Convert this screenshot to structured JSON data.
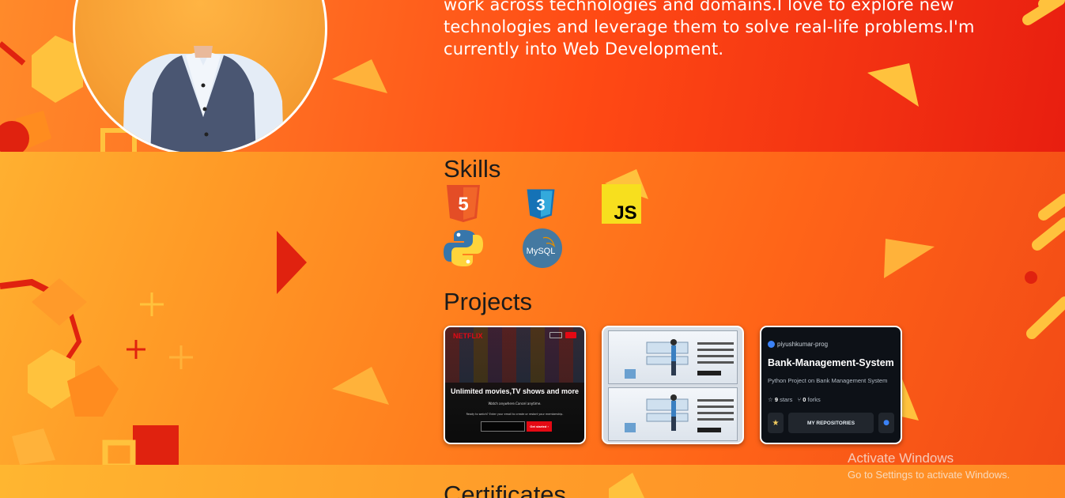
{
  "about": {
    "text": "work across technologies and domains.I love to explore new technologies and leverage them to solve real-life problems.I'm currently into Web Development."
  },
  "skills": {
    "title": "Skills",
    "items": [
      {
        "name": "HTML5",
        "icon": "html5-icon",
        "glyph": "5",
        "color": "#e44d26"
      },
      {
        "name": "CSS3",
        "icon": "css3-icon",
        "glyph": "3",
        "color": "#1572b6"
      },
      {
        "name": "JavaScript",
        "icon": "javascript-icon",
        "glyph": "JS",
        "color": "#f7df1e"
      },
      {
        "name": "Python",
        "icon": "python-icon",
        "color": "#3776ab"
      },
      {
        "name": "MySQL",
        "icon": "mysql-icon",
        "glyph": "MySQL",
        "color": "#4479a1"
      }
    ]
  },
  "projects": {
    "title": "Projects",
    "netflix": {
      "logo": "NETFLIX",
      "headline": "Unlimited movies,TV shows and more",
      "sub": "Watch anywhere.Cancel anytime.",
      "ready": "Ready to watch? Enter your email to create or restart your membership.",
      "cta": "Get started ›"
    },
    "repo": {
      "owner": "piyushkumar-prog",
      "name": "Bank-Management-System",
      "description": "Python Project on Bank Management System",
      "stars_count": "9",
      "stars_label": "stars",
      "forks_count": "0",
      "forks_label": "forks",
      "button": "MY REPOSITORIES"
    }
  },
  "certificates": {
    "title": "Certificates"
  },
  "windows_watermark": {
    "line1": "Activate Windows",
    "line2": "Go to Settings to activate Windows."
  },
  "colors": {
    "accent": "#ff6a1a",
    "deco_yellow": "#ffc23d",
    "deco_red": "#e0220f"
  }
}
